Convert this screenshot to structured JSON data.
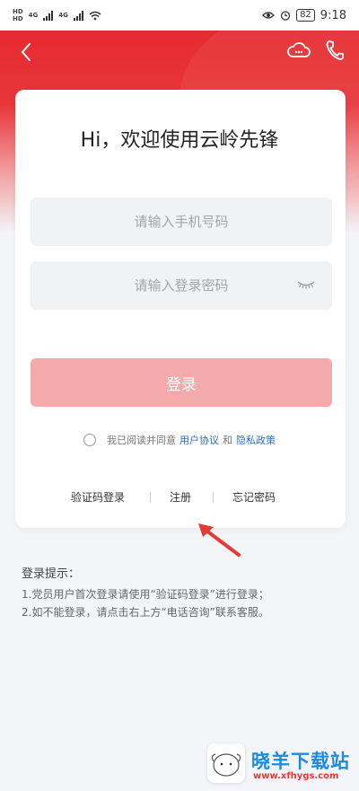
{
  "status_bar": {
    "sim1_tag": "HD",
    "sim2_tag": "HD",
    "net1": "4G",
    "net2": "4G",
    "battery": "82",
    "time": "9:18"
  },
  "nav": {
    "back_icon": "chevron-left-icon",
    "cloud_icon": "cloud-icon",
    "phone_icon": "phone-icon"
  },
  "login": {
    "title": "Hi，欢迎使用云岭先锋",
    "phone_placeholder": "请输入手机号码",
    "password_placeholder": "请输入登录密码",
    "login_button": "登录",
    "agree_prefix": "我已阅读并同意",
    "user_agreement": "用户协议",
    "and_text": "和",
    "privacy_policy": "隐私政策",
    "sms_login": "验证码登录",
    "register": "注册",
    "forgot_password": "忘记密码"
  },
  "tips": {
    "title": "登录提示：",
    "line1": "1.党员用户首次登录请使用“验证码登录”进行登录；",
    "line2": "2.如不能登录，请点击右上方“电话咨询”联系客服。"
  },
  "watermark": {
    "name": "晓羊下载站",
    "url": "www.xfhygs.com"
  },
  "colors": {
    "brand_red": "#e4262c",
    "button_disabled": "#f4aaaa",
    "link_blue": "#2d6fc3"
  }
}
